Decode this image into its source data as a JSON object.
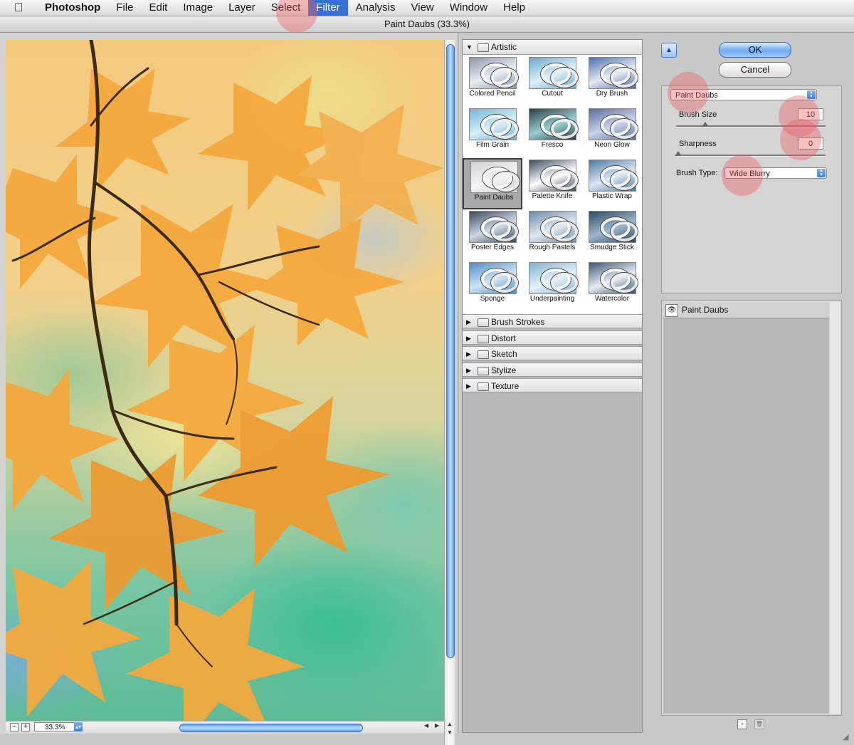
{
  "menubar": {
    "apple_icon": "apple-logo-icon",
    "items": [
      "Photoshop",
      "File",
      "Edit",
      "Image",
      "Layer",
      "Select",
      "Filter",
      "Analysis",
      "View",
      "Window",
      "Help"
    ],
    "active": "Filter"
  },
  "window": {
    "title": "Paint Daubs (33.3%)"
  },
  "preview": {
    "zoom": "33.3%",
    "zoom_out": "−",
    "zoom_in": "+"
  },
  "gallery": {
    "open_category": "Artistic",
    "filters": [
      {
        "label": "Colored Pencil"
      },
      {
        "label": "Cutout"
      },
      {
        "label": "Dry Brush"
      },
      {
        "label": "Film Grain"
      },
      {
        "label": "Fresco"
      },
      {
        "label": "Neon Glow"
      },
      {
        "label": "Paint Daubs"
      },
      {
        "label": "Palette Knife"
      },
      {
        "label": "Plastic Wrap"
      },
      {
        "label": "Poster Edges"
      },
      {
        "label": "Rough Pastels"
      },
      {
        "label": "Smudge Stick"
      },
      {
        "label": "Sponge"
      },
      {
        "label": "Underpainting"
      },
      {
        "label": "Watercolor"
      }
    ],
    "selected": "Paint Daubs",
    "collapsed_categories": [
      "Brush Strokes",
      "Distort",
      "Sketch",
      "Stylize",
      "Texture"
    ]
  },
  "buttons": {
    "ok": "OK",
    "cancel": "Cancel"
  },
  "settings": {
    "filter_select": "Paint Daubs",
    "brush_size_label": "Brush Size",
    "brush_size": "10",
    "sharpness_label": "Sharpness",
    "sharpness": "0",
    "brush_type_label": "Brush Type:",
    "brush_type": "Wide Blurry"
  },
  "layers": {
    "items": [
      {
        "name": "Paint Daubs"
      }
    ]
  },
  "colors": {
    "accent": "#3a70d6",
    "highlight": "#f05a64"
  }
}
